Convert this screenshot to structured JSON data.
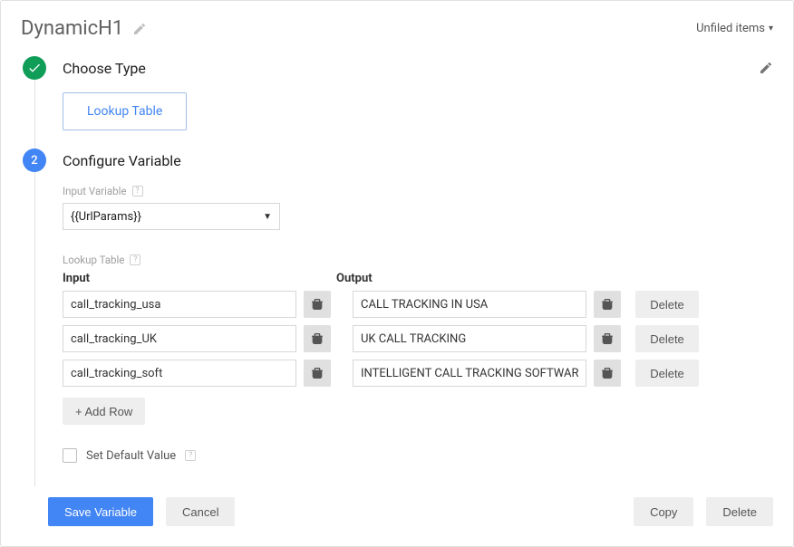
{
  "header": {
    "title": "DynamicH1",
    "folder_label": "Unfiled items"
  },
  "step1": {
    "title": "Choose Type",
    "type_chip": "Lookup Table"
  },
  "step2": {
    "title": "Configure Variable",
    "marker": "2",
    "input_variable_label": "Input Variable",
    "input_variable_value": "{{UrlParams}}",
    "lookup_table_label": "Lookup Table",
    "columns": {
      "input": "Input",
      "output": "Output"
    },
    "rows": [
      {
        "input": "call_tracking_usa",
        "output": "CALL TRACKING IN USA"
      },
      {
        "input": "call_tracking_UK",
        "output": "UK CALL TRACKING"
      },
      {
        "input": "call_tracking_soft",
        "output": "INTELLIGENT CALL TRACKING SOFTWARE"
      }
    ],
    "delete_label": "Delete",
    "add_row_label": "+ Add Row",
    "set_default_label": "Set Default Value"
  },
  "footer": {
    "save": "Save Variable",
    "cancel": "Cancel",
    "copy": "Copy",
    "delete": "Delete"
  }
}
